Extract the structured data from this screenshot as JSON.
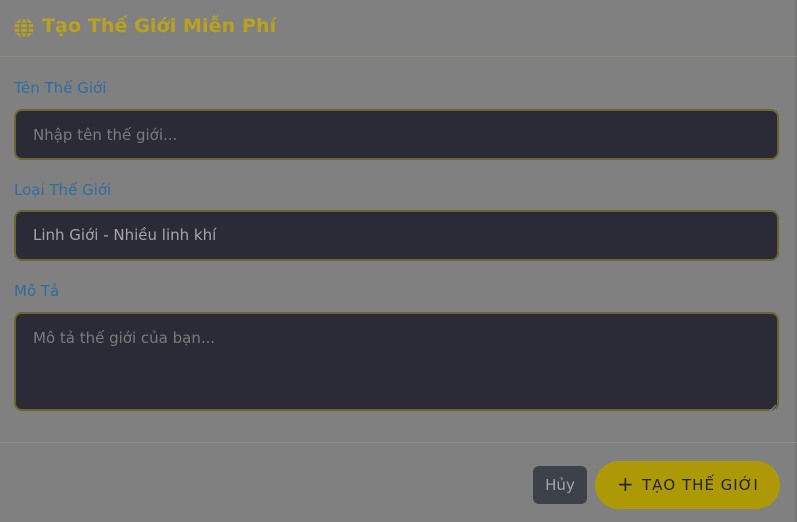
{
  "modal": {
    "title": "Tạo Thế Giới Miễn Phí",
    "header_icon": "globe-icon"
  },
  "form": {
    "name_label": "Tên Thế Giới",
    "name_placeholder": "Nhập tên thế giới...",
    "name_value": "",
    "type_label": "Loại Thế Giới",
    "type_selected": "Linh Giới - Nhiều linh khí",
    "description_label": "Mô Tả",
    "description_placeholder": "Mô tả thế giới của bạn...",
    "description_value": ""
  },
  "footer": {
    "cancel_label": "Hủy",
    "create_icon": "plus-icon",
    "create_label": "TẠO THẾ GIỚI"
  },
  "colors": {
    "overlay_background": "#808080",
    "title_accent": "#b9a21f",
    "label_color": "#2e6e9e",
    "field_background": "#2a2b37",
    "field_border": "#6b6530",
    "primary_button": "#ad9906",
    "secondary_button": "#3d414a"
  }
}
